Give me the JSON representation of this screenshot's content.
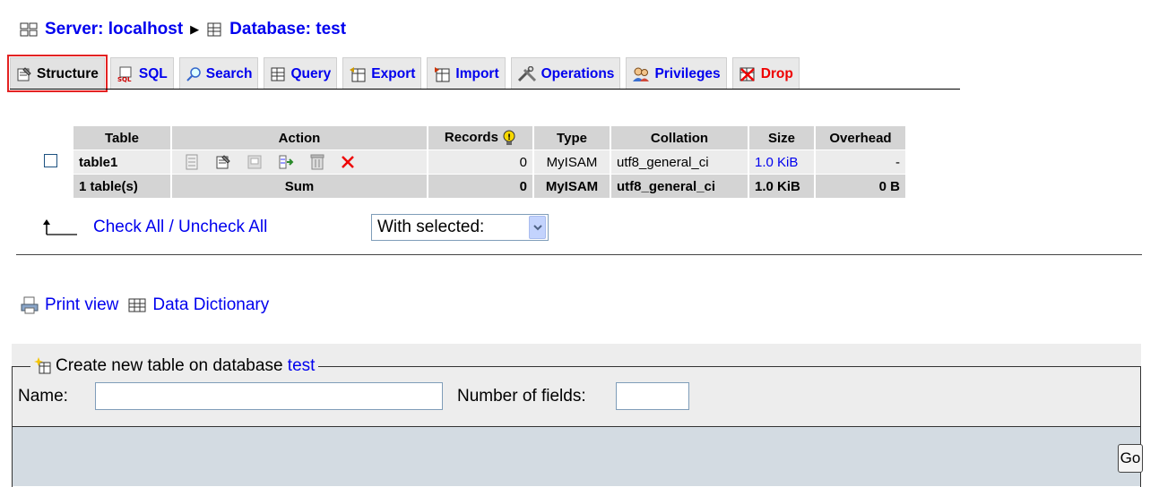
{
  "breadcrumb": {
    "server": "Server: localhost",
    "database": "Database: test"
  },
  "tabs": [
    {
      "label": "Structure",
      "icon": "structure-icon",
      "active": true
    },
    {
      "label": "SQL",
      "icon": "sql-icon"
    },
    {
      "label": "Search",
      "icon": "search-icon"
    },
    {
      "label": "Query",
      "icon": "query-icon"
    },
    {
      "label": "Export",
      "icon": "export-icon"
    },
    {
      "label": "Import",
      "icon": "import-icon"
    },
    {
      "label": "Operations",
      "icon": "operations-icon"
    },
    {
      "label": "Privileges",
      "icon": "privileges-icon"
    },
    {
      "label": "Drop",
      "icon": "drop-icon"
    }
  ],
  "table": {
    "headers": [
      "Table",
      "Action",
      "Records",
      "Type",
      "Collation",
      "Size",
      "Overhead"
    ],
    "rows": [
      {
        "name": "table1",
        "records": "0",
        "type": "MyISAM",
        "collation": "utf8_general_ci",
        "size": "1.0 KiB",
        "overhead": "-"
      }
    ],
    "sum": {
      "name": "1 table(s)",
      "action": "Sum",
      "records": "0",
      "type": "MyISAM",
      "collation": "utf8_general_ci",
      "size": "1.0 KiB",
      "overhead": "0 B"
    }
  },
  "check_all_label": "Check All / Uncheck All",
  "with_selected": "With selected:",
  "links": {
    "print_view": "Print view",
    "data_dictionary": "Data Dictionary"
  },
  "create": {
    "legend_prefix": "Create new table on database ",
    "legend_db": "test",
    "name_label": "Name:",
    "name_value": "",
    "fields_label": "Number of fields:",
    "fields_value": "",
    "go_label": "Go"
  },
  "colors": {
    "link": "#0000ee",
    "drop": "#ee0000",
    "highlight": "#e32222"
  }
}
